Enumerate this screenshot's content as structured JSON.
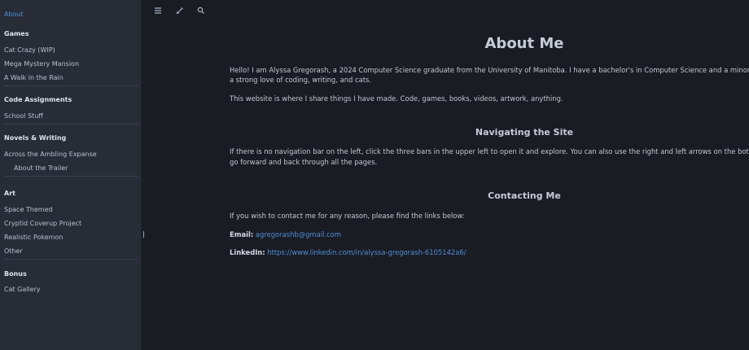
{
  "sidebar": {
    "about": "About",
    "sections": [
      {
        "title": "Games",
        "items": [
          "Cat Crazy (WIP)",
          "Mega Mystery Mansion",
          "A Walk in the Rain"
        ]
      },
      {
        "title": "Code Assignments",
        "items": [
          "School Stuff"
        ]
      },
      {
        "title": "Novels & Writing",
        "items": [
          "Across the Ambling Expanse"
        ],
        "subitems": [
          "About the Trailer"
        ]
      },
      {
        "title": "Art",
        "items": [
          "Space Themed",
          "Cryptid Coverup Project",
          "Realistic Pokemon",
          "Other"
        ]
      },
      {
        "title": "Bonus",
        "items": [
          "Cat Gallery"
        ]
      }
    ]
  },
  "toolbar": {
    "icons": [
      "menu-icon",
      "edit-icon",
      "search-icon"
    ]
  },
  "main": {
    "title": "About Me",
    "intro_line1": "Hello! I am Alyssa Gregorash, a 2024 Computer Science graduate from the University of Manitoba. I have a bachelor's in Computer Science and a minor in",
    "intro_line2": "a strong love of coding, writing, and cats.",
    "website": "This website is where I share things I have made. Code, games, books, videos, artwork, anything.",
    "nav_heading": "Navigating the Site",
    "nav_line1": "If there is no navigation bar on the left, click the three bars in the upper left to open it and explore. You can also use the right and left arrows on the bott",
    "nav_line2": "go forward and back through all the pages.",
    "contact_heading": "Contacting Me",
    "contact_intro": "If you wish to contact me for any reason, please find the links below:",
    "email_label": "Email:",
    "email_value": "agregorashb@gmail.com",
    "linkedin_label": "LinkedIn:",
    "linkedin_value": "https://www.linkedin.com/in/alyssa-gregorash-6105142a6/"
  },
  "colors": {
    "sidebar_bg": "#272c37",
    "main_bg": "#1a1c24",
    "accent": "#4f8fd6"
  }
}
